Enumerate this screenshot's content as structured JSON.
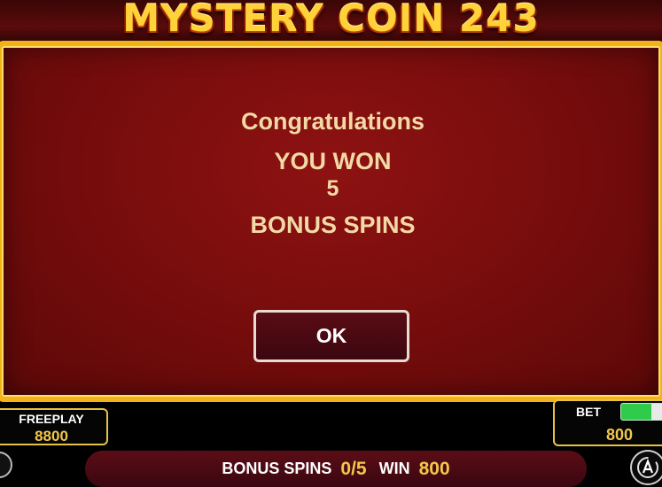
{
  "game": {
    "title": "MYSTERY  COIN 243"
  },
  "dialog": {
    "congrats": "Congratulations",
    "you_won": "YOU WON",
    "count": "5",
    "bonus": "BONUS SPINS",
    "ok_label": "OK"
  },
  "freeplay": {
    "label": "FREEPLAY",
    "value": "8800"
  },
  "bet": {
    "label": "BET",
    "value": "800"
  },
  "status_bar": {
    "bonus_label": "BONUS SPINS",
    "bonus_value": "0/5",
    "win_label": "WIN",
    "win_value": "800"
  },
  "icons": {
    "auto_play": "auto-play-icon",
    "menu": "menu-icon"
  },
  "colors": {
    "accent_gold": "#f2c84a",
    "frame_gold": "#f2b21a",
    "dialog_red": "#7a0d0d",
    "toggle_green": "#2ecc4a"
  }
}
